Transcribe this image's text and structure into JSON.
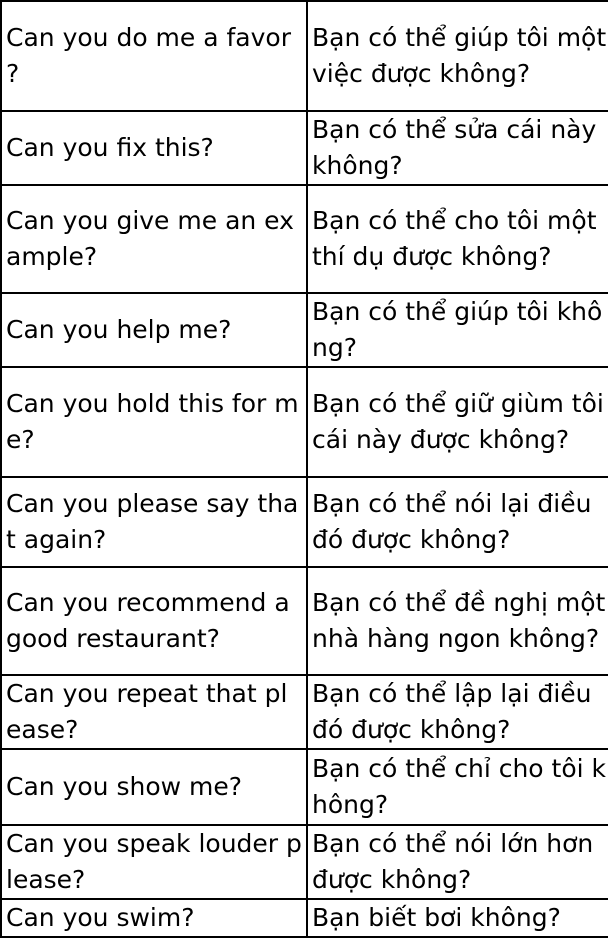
{
  "rows": [
    {
      "en": "Can you do me a favor ?",
      "vi": "Bạn có thể giúp tôi một việc được không?"
    },
    {
      "en": "Can you fix this?",
      "vi": "Bạn có thể sửa cái này không?"
    },
    {
      "en": "Can you give me an example?",
      "vi": "Bạn có thể cho tôi một thí dụ được không?"
    },
    {
      "en": "Can you help me?",
      "vi": "Bạn có thể giúp tôi không?"
    },
    {
      "en": "Can you hold this for me?",
      "vi": "Bạn có thể giữ giùm tôi cái này được không?"
    },
    {
      "en": "Can you please say that again?",
      "vi": "Bạn có thể nói lại điều đó được không?"
    },
    {
      "en": "Can you recommend a good restaurant?",
      "vi": "Bạn có thể đề nghị một nhà hàng ngon không?"
    },
    {
      "en": "Can you repeat that please?",
      "vi": "Bạn có thể lập lại điều đó được không?"
    },
    {
      "en": "Can you show me?",
      "vi": "Bạn có thể chỉ cho tôi không?"
    },
    {
      "en": "Can you speak louder please?",
      "vi": "Bạn có thể nói lớn hơn được không?"
    },
    {
      "en": "Can you swim?",
      "vi": "Bạn biết bơi không?"
    }
  ]
}
